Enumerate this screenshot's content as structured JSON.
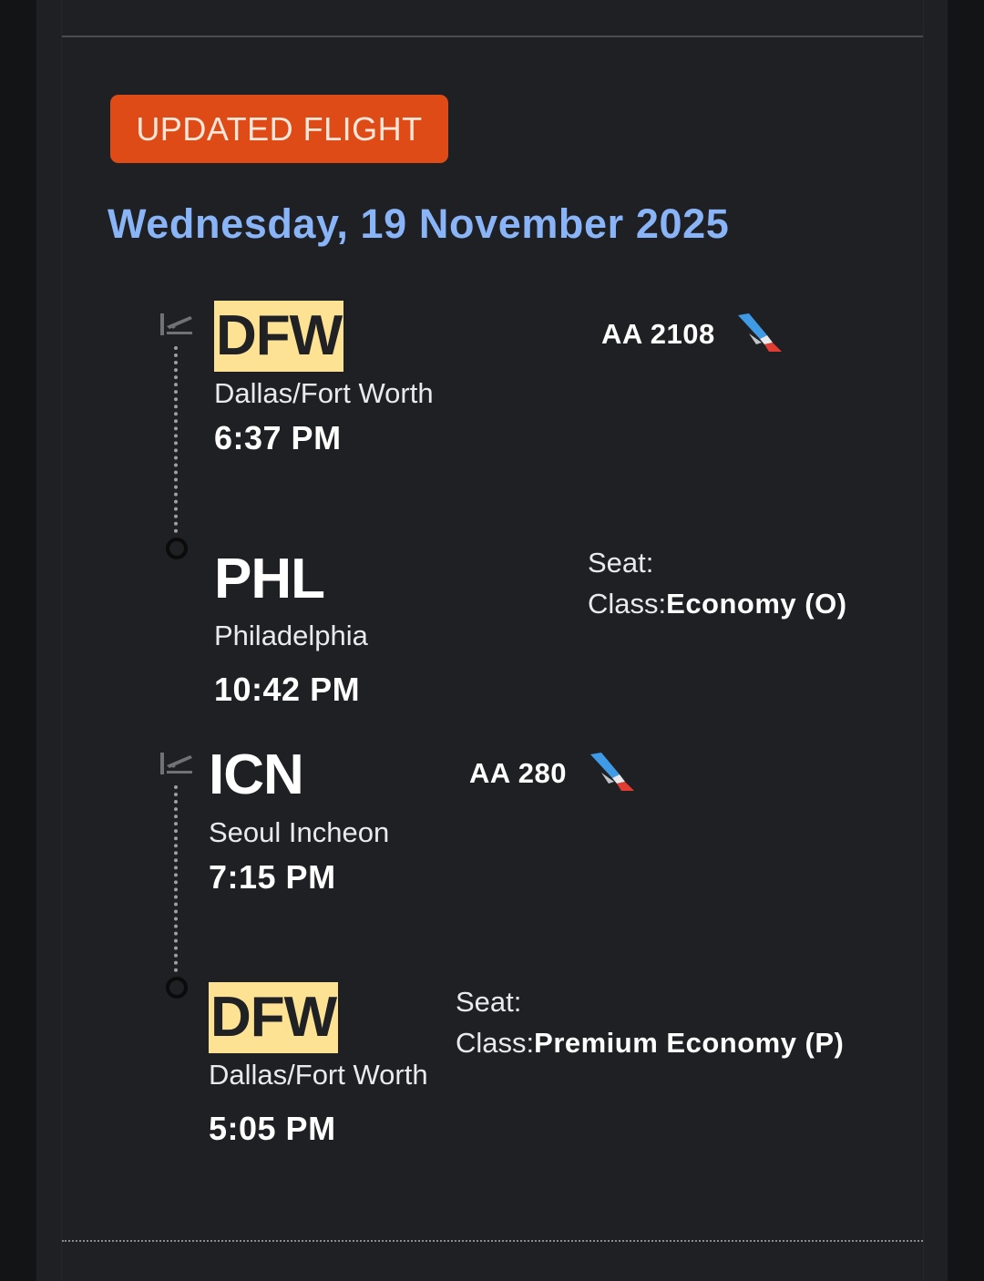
{
  "badge": "UPDATED FLIGHT",
  "date": "Wednesday, 19 November 2025",
  "colors": {
    "badge": "#de4b16",
    "date": "#8ab4f8",
    "highlight": "#fde293",
    "background": "#1f2023"
  },
  "icons": {
    "departure": "takeoff-icon",
    "arrival": "arrival-ring-icon",
    "airline": "american-airlines-logo-icon"
  },
  "segments": [
    {
      "flight": "AA 2108",
      "departure": {
        "code": "DFW",
        "city": "Dallas/Fort Worth",
        "time": "6:37 PM",
        "highlighted": true
      },
      "arrival": {
        "code": "PHL",
        "city": "Philadelphia",
        "time": "10:42 PM",
        "highlighted": false
      },
      "seat_label": "Seat:",
      "class_label": "Class:",
      "class_value": "Economy (O)"
    },
    {
      "flight": "AA 280",
      "departure": {
        "code": "ICN",
        "city": "Seoul Incheon",
        "time": "7:15 PM",
        "highlighted": false
      },
      "arrival": {
        "code": "DFW",
        "city": "Dallas/Fort Worth",
        "time": "5:05 PM",
        "highlighted": true
      },
      "seat_label": "Seat:",
      "class_label": "Class:",
      "class_value": "Premium Economy (P)"
    }
  ]
}
